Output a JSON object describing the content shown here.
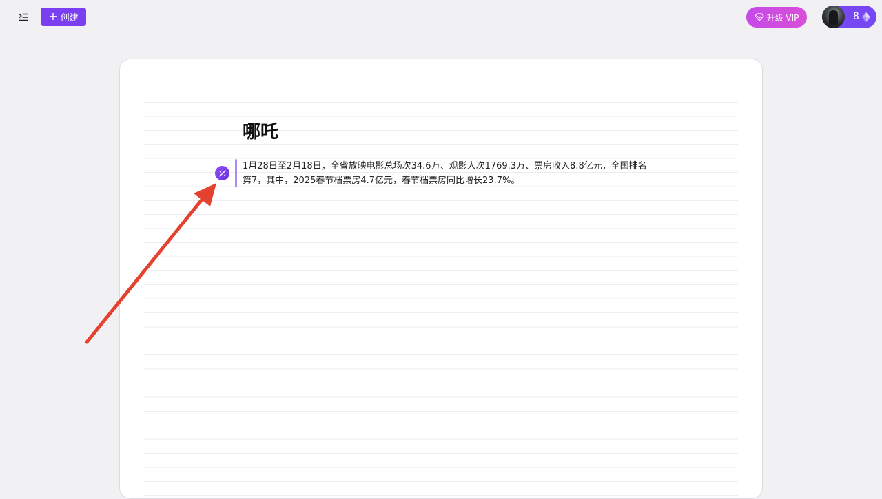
{
  "toolbar": {
    "create_label": "创建",
    "vip_label": "升级 VIP",
    "credits": "8"
  },
  "note": {
    "title": "哪吒",
    "body": "1月28日至2月18日，全省放映电影总场次34.6万、观影人次1769.3万、票房收入8.8亿元，全国排名第7，其中，2025春节档票房4.7亿元，春节档票房同比增长23.7%。"
  },
  "colors": {
    "accent": "#7a3ff0",
    "vip_gradient_start": "#c54ae8",
    "annotation_arrow": "#e5412f"
  },
  "icons": {
    "menu": "menu-toggle-icon",
    "plus": "plus-icon",
    "vip": "diamond-outline-icon",
    "credits": "diamond-icon",
    "ai": "magic-wand-icon"
  }
}
